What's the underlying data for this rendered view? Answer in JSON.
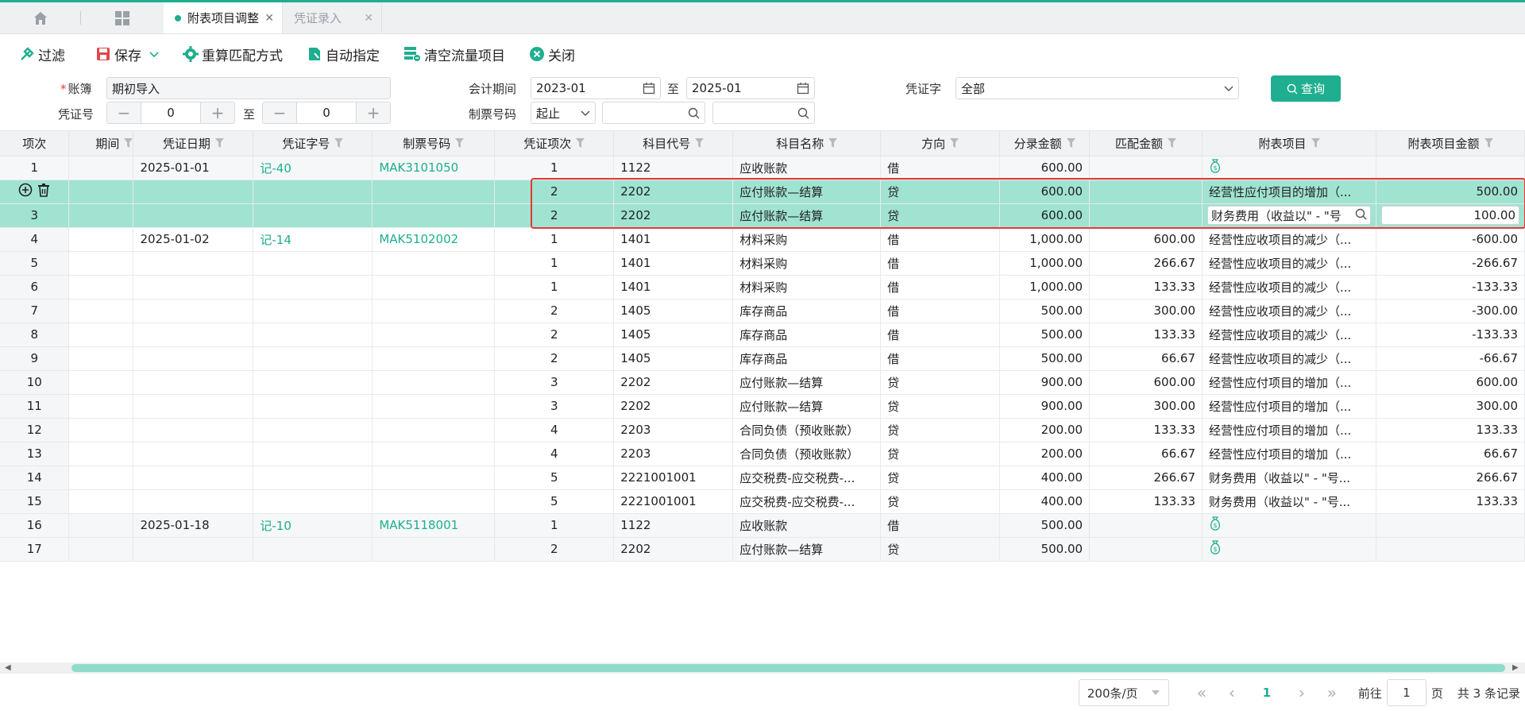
{
  "tabs": [
    {
      "label": "附表项目调整",
      "active": true
    },
    {
      "label": "凭证录入",
      "active": false
    }
  ],
  "toolbar": {
    "filter": "过滤",
    "save": "保存",
    "recalc": "重算匹配方式",
    "auto_assign": "自动指定",
    "clear_flow": "清空流量项目",
    "close": "关闭"
  },
  "filters": {
    "ledger_label": "账簿",
    "ledger_value": "期初导入",
    "voucher_no_label": "凭证号",
    "voucher_no_from": "0",
    "voucher_no_to": "0",
    "to_label": "至",
    "period_label": "会计期间",
    "period_from": "2023-01",
    "period_to": "2025-01",
    "invoice_label": "制票号码",
    "invoice_mode": "起止",
    "invoice_from": "",
    "invoice_to": "",
    "voucher_word_label": "凭证字",
    "voucher_word_value": "全部",
    "query_button": "查询"
  },
  "table": {
    "columns": [
      "项次",
      "期间",
      "凭证日期",
      "凭证字号",
      "制票号码",
      "凭证项次",
      "科目代号",
      "科目名称",
      "方向",
      "分录金额",
      "匹配金额",
      "附表项目",
      "附表项目金额"
    ],
    "rows": [
      {
        "idx": "1",
        "date": "2025-01-01",
        "vno": "记-40",
        "inv": "MAK3101050",
        "item": "1",
        "code": "1122",
        "name": "应收账款",
        "dir": "借",
        "amt": "600.00",
        "match": "",
        "proj": "",
        "proj_icon": true,
        "pamt": "",
        "style": "gray"
      },
      {
        "idx": "",
        "date": "",
        "vno": "",
        "inv": "",
        "item": "2",
        "code": "2202",
        "name": "应付账款—结算",
        "dir": "贷",
        "amt": "600.00",
        "match": "",
        "proj": "经营性应付项目的增加（...",
        "pamt": "500.00",
        "style": "sel",
        "actions": true
      },
      {
        "idx": "3",
        "date": "",
        "vno": "",
        "inv": "",
        "item": "2",
        "code": "2202",
        "name": "应付账款—结算",
        "dir": "贷",
        "amt": "600.00",
        "match": "",
        "proj": "财务费用（收益以\" - \"号",
        "pamt": "100.00",
        "style": "sel",
        "editing": true
      },
      {
        "idx": "4",
        "date": "2025-01-02",
        "vno": "记-14",
        "inv": "MAK5102002",
        "item": "1",
        "code": "1401",
        "name": "材料采购",
        "dir": "借",
        "amt": "1,000.00",
        "match": "600.00",
        "proj": "经营性应收项目的减少（...",
        "pamt": "-600.00",
        "style": ""
      },
      {
        "idx": "5",
        "date": "",
        "vno": "",
        "inv": "",
        "item": "1",
        "code": "1401",
        "name": "材料采购",
        "dir": "借",
        "amt": "1,000.00",
        "match": "266.67",
        "proj": "经营性应收项目的减少（...",
        "pamt": "-266.67",
        "style": ""
      },
      {
        "idx": "6",
        "date": "",
        "vno": "",
        "inv": "",
        "item": "1",
        "code": "1401",
        "name": "材料采购",
        "dir": "借",
        "amt": "1,000.00",
        "match": "133.33",
        "proj": "经营性应收项目的减少（...",
        "pamt": "-133.33",
        "style": ""
      },
      {
        "idx": "7",
        "date": "",
        "vno": "",
        "inv": "",
        "item": "2",
        "code": "1405",
        "name": "库存商品",
        "dir": "借",
        "amt": "500.00",
        "match": "300.00",
        "proj": "经营性应收项目的减少（...",
        "pamt": "-300.00",
        "style": ""
      },
      {
        "idx": "8",
        "date": "",
        "vno": "",
        "inv": "",
        "item": "2",
        "code": "1405",
        "name": "库存商品",
        "dir": "借",
        "amt": "500.00",
        "match": "133.33",
        "proj": "经营性应收项目的减少（...",
        "pamt": "-133.33",
        "style": ""
      },
      {
        "idx": "9",
        "date": "",
        "vno": "",
        "inv": "",
        "item": "2",
        "code": "1405",
        "name": "库存商品",
        "dir": "借",
        "amt": "500.00",
        "match": "66.67",
        "proj": "经营性应收项目的减少（...",
        "pamt": "-66.67",
        "style": ""
      },
      {
        "idx": "10",
        "date": "",
        "vno": "",
        "inv": "",
        "item": "3",
        "code": "2202",
        "name": "应付账款—结算",
        "dir": "贷",
        "amt": "900.00",
        "match": "600.00",
        "proj": "经营性应付项目的增加（...",
        "pamt": "600.00",
        "style": ""
      },
      {
        "idx": "11",
        "date": "",
        "vno": "",
        "inv": "",
        "item": "3",
        "code": "2202",
        "name": "应付账款—结算",
        "dir": "贷",
        "amt": "900.00",
        "match": "300.00",
        "proj": "经营性应付项目的增加（...",
        "pamt": "300.00",
        "style": ""
      },
      {
        "idx": "12",
        "date": "",
        "vno": "",
        "inv": "",
        "item": "4",
        "code": "2203",
        "name": "合同负债（预收账款）",
        "dir": "贷",
        "amt": "200.00",
        "match": "133.33",
        "proj": "经营性应付项目的增加（...",
        "pamt": "133.33",
        "style": ""
      },
      {
        "idx": "13",
        "date": "",
        "vno": "",
        "inv": "",
        "item": "4",
        "code": "2203",
        "name": "合同负债（预收账款）",
        "dir": "贷",
        "amt": "200.00",
        "match": "66.67",
        "proj": "经营性应付项目的增加（...",
        "pamt": "66.67",
        "style": ""
      },
      {
        "idx": "14",
        "date": "",
        "vno": "",
        "inv": "",
        "item": "5",
        "code": "2221001001",
        "name": "应交税费-应交税费-...",
        "dir": "贷",
        "amt": "400.00",
        "match": "266.67",
        "proj": "财务费用（收益以\" - \"号...",
        "pamt": "266.67",
        "style": ""
      },
      {
        "idx": "15",
        "date": "",
        "vno": "",
        "inv": "",
        "item": "5",
        "code": "2221001001",
        "name": "应交税费-应交税费-...",
        "dir": "贷",
        "amt": "400.00",
        "match": "133.33",
        "proj": "财务费用（收益以\" - \"号...",
        "pamt": "133.33",
        "style": ""
      },
      {
        "idx": "16",
        "date": "2025-01-18",
        "vno": "记-10",
        "inv": "MAK5118001",
        "item": "1",
        "code": "1122",
        "name": "应收账款",
        "dir": "借",
        "amt": "500.00",
        "match": "",
        "proj": "",
        "proj_icon": true,
        "pamt": "",
        "style": "gray"
      },
      {
        "idx": "17",
        "date": "",
        "vno": "",
        "inv": "",
        "item": "2",
        "code": "2202",
        "name": "应付账款—结算",
        "dir": "贷",
        "amt": "500.00",
        "match": "",
        "proj": "",
        "proj_icon": true,
        "pamt": "",
        "style": "gray"
      }
    ]
  },
  "pager": {
    "page_size": "200条/页",
    "current_page": "1",
    "goto_label": "前往",
    "goto_value": "1",
    "page_unit": "页",
    "total": "共 3 条记录"
  },
  "colors": {
    "accent": "#1fae8f",
    "selected_row": "#a0e3d0",
    "highlight_border": "#e53935"
  },
  "icons": [
    "home-icon",
    "apps-grid-icon",
    "filter-tool-icon",
    "save-icon",
    "chevron-down-icon",
    "gear-icon",
    "assign-icon",
    "clear-list-icon",
    "close-circle-icon",
    "calendar-icon",
    "search-icon",
    "add-circle-icon",
    "delete-icon",
    "money-bag-icon",
    "column-filter-icon"
  ]
}
